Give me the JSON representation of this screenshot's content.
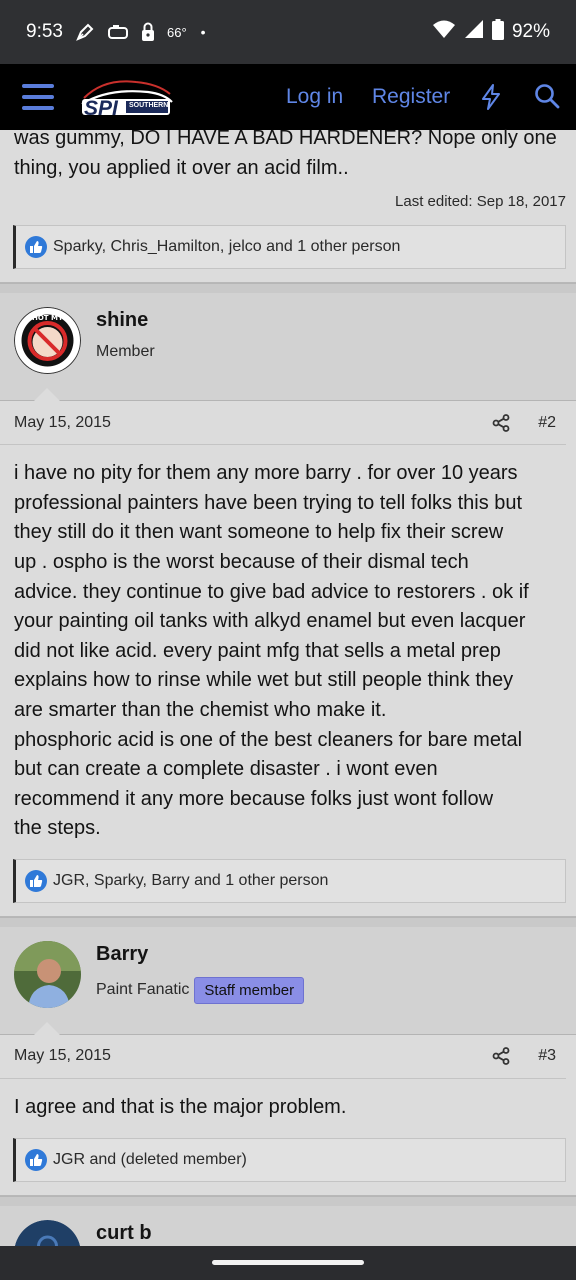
{
  "status_bar": {
    "time": "9:53",
    "temperature": "66°",
    "dot": "•",
    "battery": "92%",
    "icons": [
      "pen-nib-icon",
      "gamepad-icon",
      "lock-icon",
      "wifi-icon",
      "signal-icon",
      "battery-icon"
    ]
  },
  "nav": {
    "logo_text": "SPI",
    "logo_sub": "SOUTHERN",
    "login": "Log in",
    "register": "Register",
    "icons": [
      "menu-icon",
      "bolt-icon",
      "search-icon"
    ],
    "accent": "#5f86e6"
  },
  "post1": {
    "text_lines": [
      "was gummy, DO I HAVE A BAD HARDENER? Nope only one",
      "thing, you applied it over an acid film.."
    ],
    "edited": "Last edited: Sep 18, 2017",
    "reactions": "Sparky, Chris_Hamilton, jelco and 1 other person"
  },
  "post2": {
    "username": "shine",
    "user_title": "Member",
    "date": "May 15, 2015",
    "number": "#2",
    "text_lines": [
      "i have no pity for them any more barry . for over 10 years",
      "professional painters have been trying to tell folks this but",
      "they still do it then want someone to help fix their screw",
      "up . ospho is the worst because of their dismal tech",
      "advice. they continue to give bad advice to restorers . ok if",
      "your painting oil tanks with alkyd enamel but even lacquer",
      "did not like acid. every paint mfg that sells a metal prep",
      "explains how to rinse while wet but still people think they",
      "are smarter than the chemist who make it.",
      "phosphoric acid is one of the best cleaners for bare metal",
      "but can create a complete disaster . i wont even",
      "recommend it any more because folks just wont follow",
      "the steps."
    ],
    "reactions": "JGR, Sparky, Barry and 1 other person"
  },
  "post3": {
    "username": "Barry",
    "user_title": "Paint Fanatic",
    "badge": "Staff member",
    "date": "May 15, 2015",
    "number": "#3",
    "text_lines": [
      "I agree and that is the major problem."
    ],
    "reactions": "JGR and (deleted member)"
  },
  "post4": {
    "username": "curt b"
  },
  "colors": {
    "like": "#2f79d8",
    "staff_badge": "#8a8ee6"
  }
}
